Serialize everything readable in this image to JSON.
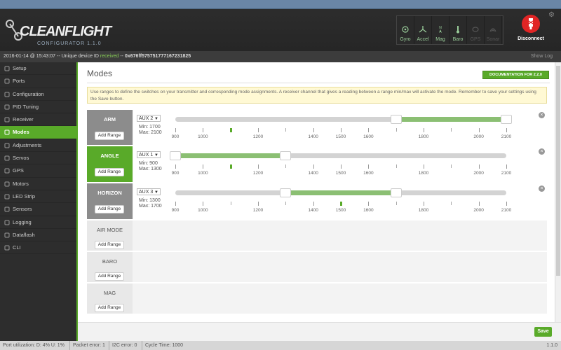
{
  "app": {
    "logo_text": "CLEANFLIGHT",
    "logo_sub": "CONFIGURATOR  1.1.0"
  },
  "sensors": [
    {
      "name": "gyro-icon",
      "label": "Gyro",
      "active": true
    },
    {
      "name": "accel-icon",
      "label": "Accel",
      "active": true
    },
    {
      "name": "mag-icon",
      "label": "Mag",
      "active": true
    },
    {
      "name": "baro-icon",
      "label": "Baro",
      "active": true
    },
    {
      "name": "gps-icon",
      "label": "GPS",
      "active": false
    },
    {
      "name": "sonar-icon",
      "label": "Sonar",
      "active": false
    }
  ],
  "disconnect": {
    "label": "Disconnect"
  },
  "status": {
    "date": "2016-01-14 @ 15:43:07",
    "mid": "-- Unique device ID",
    "received": "received",
    "sep": "--",
    "device_id": "0x676ff575751777167231825",
    "show_log": "Show Log"
  },
  "sidebar": {
    "items": [
      {
        "label": "Setup",
        "icon": "wrench-icon"
      },
      {
        "label": "Ports",
        "icon": "plug-icon"
      },
      {
        "label": "Configuration",
        "icon": "gear-icon"
      },
      {
        "label": "PID Tuning",
        "icon": "sliders-icon"
      },
      {
        "label": "Receiver",
        "icon": "receiver-icon"
      },
      {
        "label": "Modes",
        "icon": "modes-icon",
        "active": true
      },
      {
        "label": "Adjustments",
        "icon": "adjust-icon"
      },
      {
        "label": "Servos",
        "icon": "servo-icon"
      },
      {
        "label": "GPS",
        "icon": "location-icon"
      },
      {
        "label": "Motors",
        "icon": "motor-icon"
      },
      {
        "label": "LED Strip",
        "icon": "led-icon"
      },
      {
        "label": "Sensors",
        "icon": "sensor-icon"
      },
      {
        "label": "Logging",
        "icon": "log-icon"
      },
      {
        "label": "Dataflash",
        "icon": "flash-icon"
      },
      {
        "label": "CLI",
        "icon": "terminal-icon"
      }
    ]
  },
  "page": {
    "title": "Modes",
    "doc_button": "DOCUMENTATION FOR 2.2.0",
    "info": "Use ranges to define the switches on your transmitter and corresponding mode assignments. A receiver channel that gives a reading between a range min/max will activate the mode. Remember to save your settings using the Save button.",
    "add_range": "Add Range",
    "save": "Save"
  },
  "scale_ticks": [
    "900",
    "1000",
    "1200",
    "1400",
    "1500",
    "1600",
    "1800",
    "2000",
    "2100"
  ],
  "modes": [
    {
      "name": "ARM",
      "aux": "AUX 2",
      "min_label": "Min: 1700",
      "max_label": "Max: 2100",
      "min": 1700,
      "max": 2100,
      "marker": 1100,
      "state": "gray"
    },
    {
      "name": "ANGLE",
      "aux": "AUX 1",
      "min_label": "Min: 900",
      "max_label": "Max: 1300",
      "min": 900,
      "max": 1300,
      "marker": 1100,
      "state": "green"
    },
    {
      "name": "HORIZON",
      "aux": "AUX 3",
      "min_label": "Min: 1300",
      "max_label": "Max: 1700",
      "min": 1300,
      "max": 1700,
      "marker": 1500,
      "state": "gray"
    },
    {
      "name": "AIR MODE",
      "state": "lite"
    },
    {
      "name": "BARO",
      "state": "lite"
    },
    {
      "name": "MAG",
      "state": "lite"
    }
  ],
  "footer": {
    "port": "Port utilization: D: 4% U: 1%",
    "packet": "Packet error: 1",
    "i2c": "I2C error: 0",
    "cycle": "Cycle Time: 1000",
    "version": "1.1.0"
  }
}
